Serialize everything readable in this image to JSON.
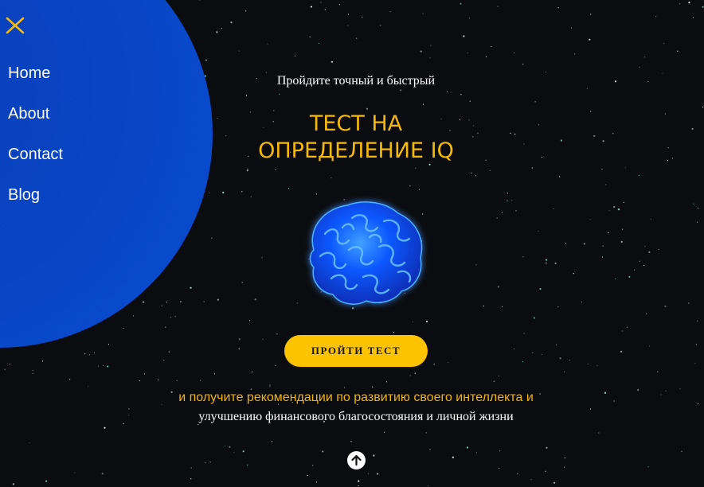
{
  "menu": {
    "close_icon": "close-icon",
    "items": [
      {
        "label": "Home"
      },
      {
        "label": "About"
      },
      {
        "label": "Contact"
      },
      {
        "label": "Blog"
      }
    ],
    "accent": "#f4b90a",
    "background": "#0846c6"
  },
  "hero": {
    "kicker": "Пройдите точный и быстрый",
    "headline_line1": "ТЕСТ НА",
    "headline_line2": "ОПРЕДЕЛЕНИЕ IQ",
    "image_icon": "brain-icon",
    "cta_label": "ПРОЙТИ ТЕСТ",
    "subtext_line1": "и получите рекомендации по развитию своего интеллекта и",
    "subtext_line2": "улучшению финансового благосостояния и личной жизни"
  },
  "footer": {
    "scroll_icon": "arrow-up-icon"
  },
  "colors": {
    "page_bg": "#0b0c0f",
    "headline": "#f4b90a",
    "cta_bg": "#fcc303"
  }
}
